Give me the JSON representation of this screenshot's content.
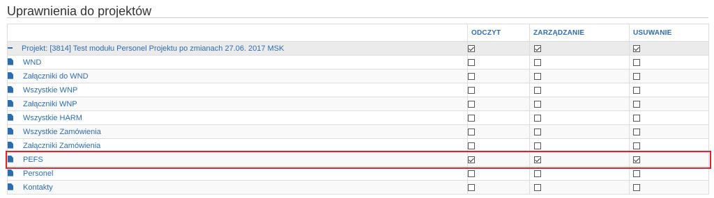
{
  "page": {
    "title": "Uprawnienia do projektów"
  },
  "columns": {
    "read": "ODCZYT",
    "manage": "ZARZĄDZANIE",
    "delete": "USUWANIE"
  },
  "project": {
    "name": "Projekt: [3814] Test modułu Personel Projektu po zmianach 27.06. 2017 MSK",
    "read": true,
    "manage": true,
    "delete": true
  },
  "items": [
    {
      "name": "WND",
      "read": false,
      "manage": false,
      "delete": false
    },
    {
      "name": "Załączniki do WND",
      "read": false,
      "manage": false,
      "delete": false
    },
    {
      "name": "Wszystkie WNP",
      "read": false,
      "manage": false,
      "delete": false
    },
    {
      "name": "Załączniki WNP",
      "read": false,
      "manage": false,
      "delete": false
    },
    {
      "name": "Wszystkie HARM",
      "read": false,
      "manage": false,
      "delete": false
    },
    {
      "name": "Wszystkie Zamówienia",
      "read": false,
      "manage": false,
      "delete": false
    },
    {
      "name": "Załączniki Zamówienia",
      "read": false,
      "manage": false,
      "delete": false
    },
    {
      "name": "PEFS",
      "read": true,
      "manage": true,
      "delete": true
    },
    {
      "name": "Personel",
      "read": false,
      "manage": false,
      "delete": false
    },
    {
      "name": "Kontakty",
      "read": false,
      "manage": false,
      "delete": false
    }
  ],
  "colors": {
    "link": "#2a6db3",
    "highlight": "#d9262c"
  }
}
